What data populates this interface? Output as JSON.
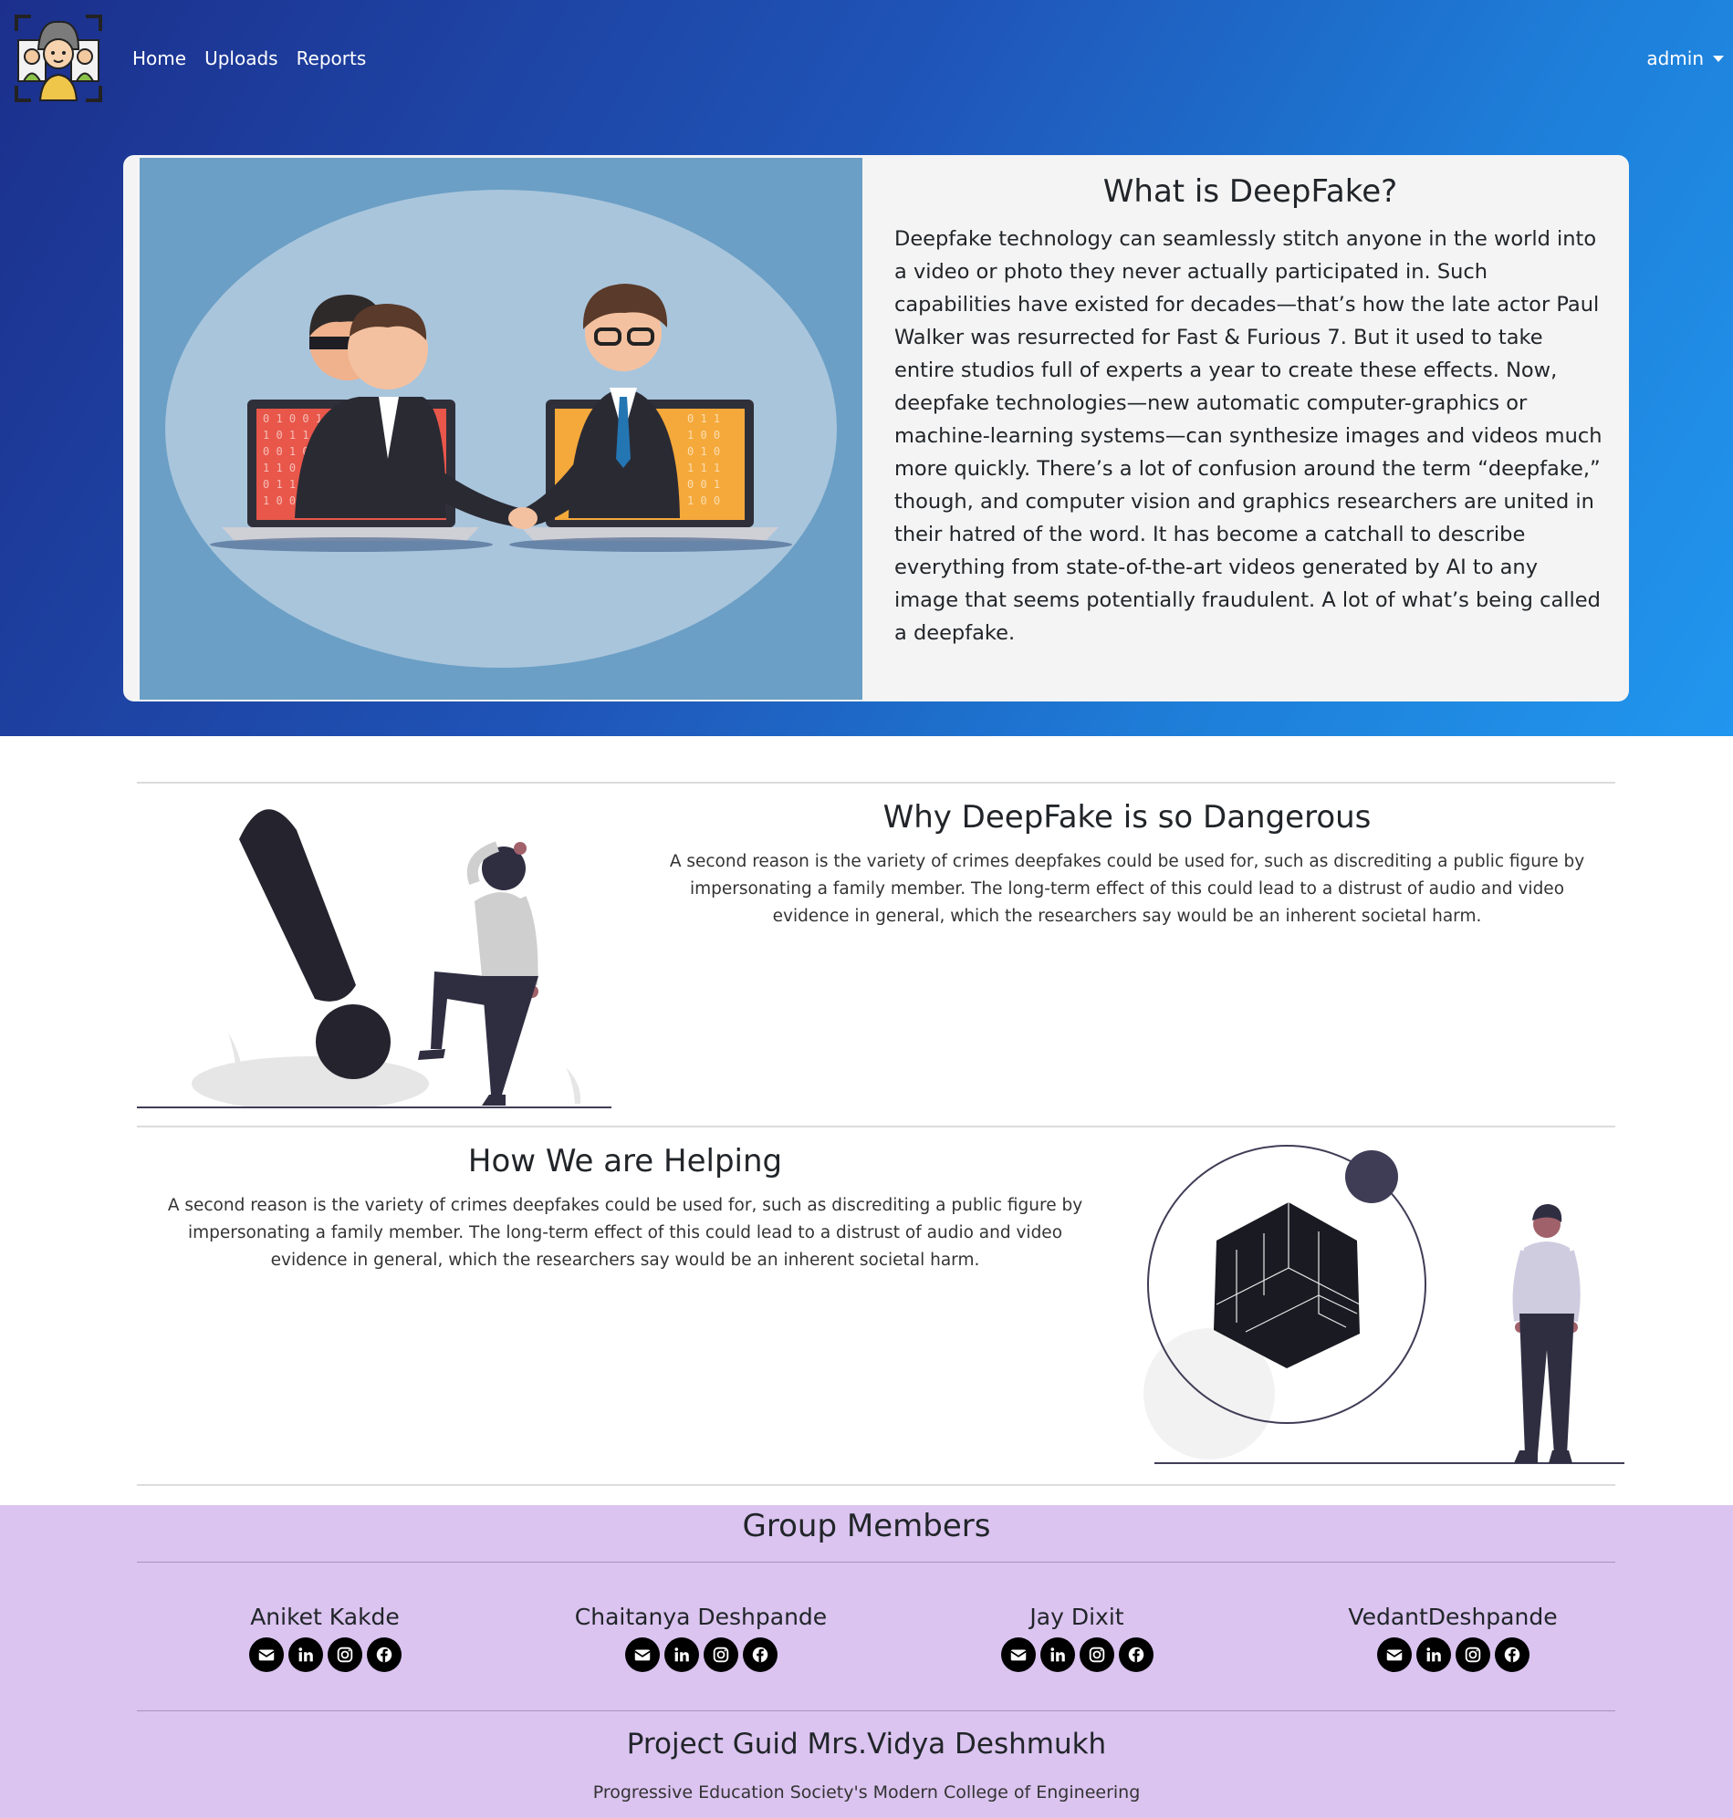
{
  "nav": {
    "items": [
      {
        "label": "Home"
      },
      {
        "label": "Uploads"
      },
      {
        "label": "Reports"
      }
    ],
    "user": "admin"
  },
  "hero": {
    "title": "What is DeepFake?",
    "body": "Deepfake technology can seamlessly stitch anyone in the world into a video or photo they never actually participated in. Such capabilities have existed for decades—that’s how the late actor Paul Walker was resurrected for Fast & Furious 7. But it used to take entire studios full of experts a year to create these effects. Now, deepfake technologies—new automatic computer-graphics or machine-learning systems—can synthesize images and videos much more quickly. There’s a lot of confusion around the term “deepfake,” though, and computer vision and graphics researchers are united in their hatred of the word. It has become a catchall to describe everything from state-of-the-art videos generated by AI to any image that seems potentially fraudulent. A lot of what’s being called a deepfake."
  },
  "danger": {
    "title": "Why DeepFake is so Dangerous",
    "body": "A second reason is the variety of crimes deepfakes could be used for, such as discrediting a public figure by impersonating a family member. The long-term effect of this could lead to a distrust of audio and video evidence in general, which the researchers say would be an inherent societal harm."
  },
  "helping": {
    "title": "How We are Helping",
    "body": "A second reason is the variety of crimes deepfakes could be used for, such as discrediting a public figure by impersonating a family member. The long-term effect of this could lead to a distrust of audio and video evidence in general, which the researchers say would be an inherent societal harm."
  },
  "footer": {
    "title": "Group Members",
    "members": [
      {
        "name": "Aniket Kakde"
      },
      {
        "name": "Chaitanya Deshpande"
      },
      {
        "name": "Jay Dixit"
      },
      {
        "name": "VedantDeshpande"
      }
    ],
    "social_icons": [
      "mail-icon",
      "linkedin-icon",
      "instagram-icon",
      "facebook-icon"
    ],
    "guide": "Project Guid Mrs.Vidya Deshmukh",
    "college": "Progressive Education Society's Modern College of Engineering"
  },
  "colors": {
    "hero_gradient_start": "#1c2f8c",
    "hero_gradient_end": "#2196ee",
    "footer_bg": "#dbc4f0",
    "card_bg": "#f4f4f4"
  }
}
